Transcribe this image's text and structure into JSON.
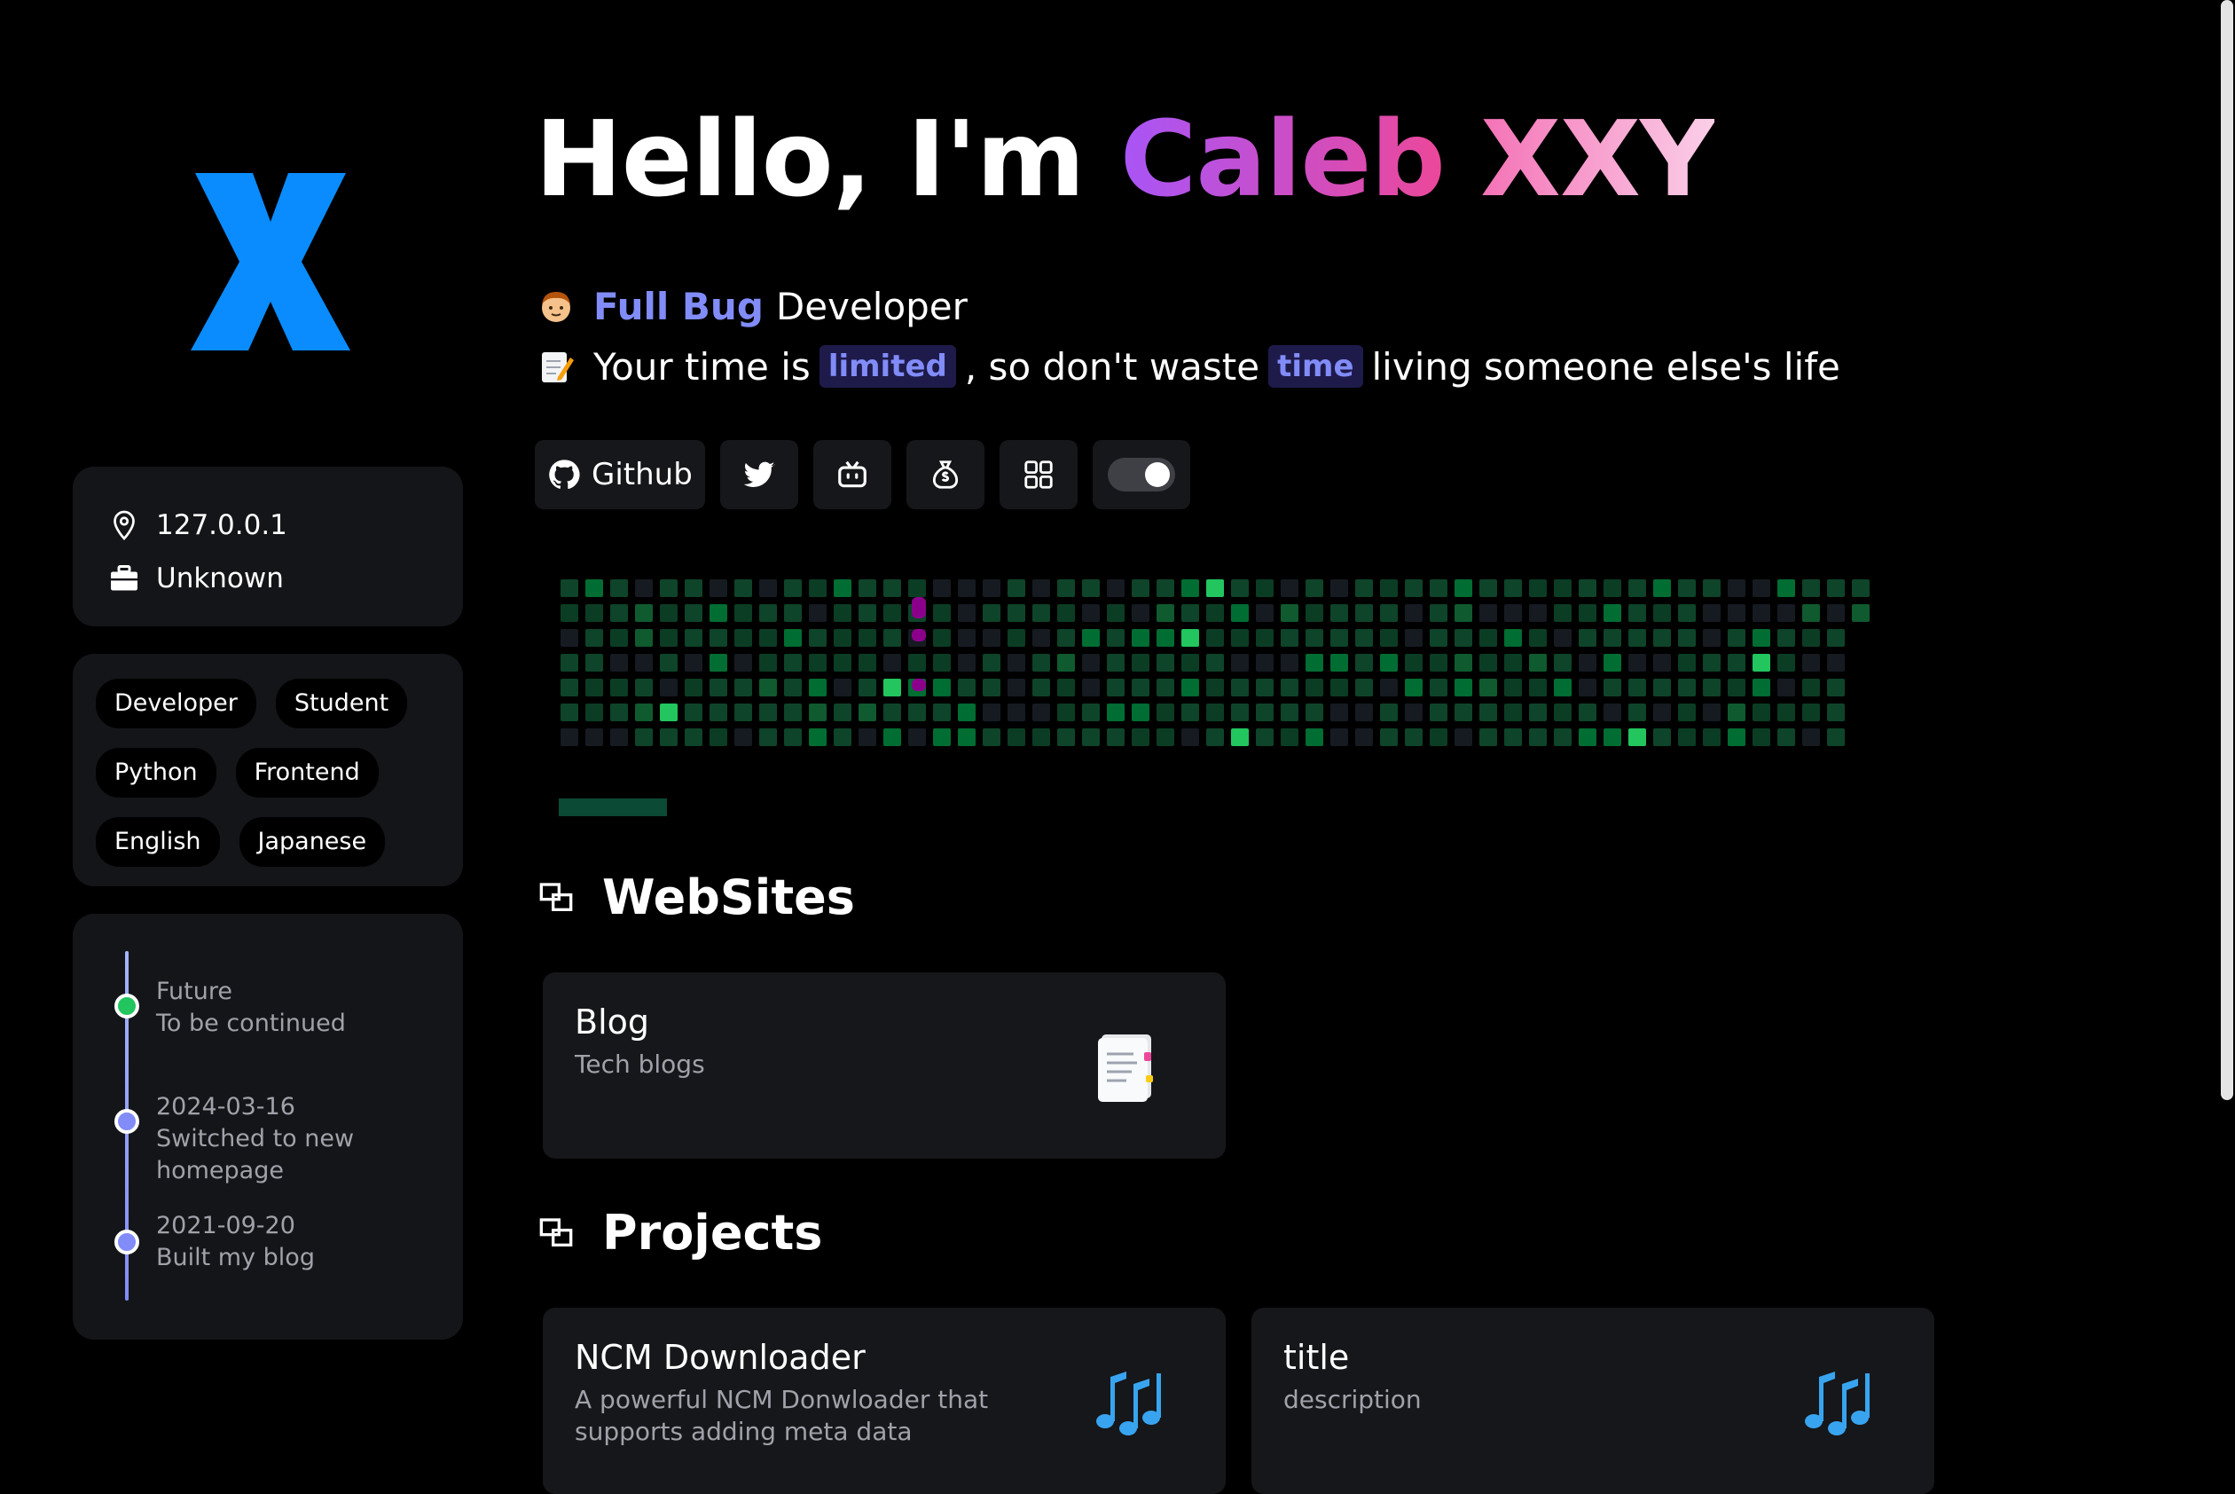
{
  "profile": {
    "avatar_letter": "X",
    "location": "127.0.0.1",
    "job": "Unknown",
    "tags": [
      "Developer",
      "Student",
      "Python",
      "Frontend",
      "English",
      "Japanese"
    ]
  },
  "timeline": [
    {
      "date": "Future",
      "text": "To be continued"
    },
    {
      "date": "2024-03-16",
      "text": "Switched to new homepage"
    },
    {
      "date": "2021-09-20",
      "text": "Built my blog"
    }
  ],
  "hero": {
    "greeting": "Hello, I'm ",
    "name_first": "Caleb",
    "name_last": "XXY",
    "role_highlight": "Full Bug",
    "role_rest": "Developer",
    "quote_part1": "Your time is",
    "quote_hl1": "limited",
    "quote_part2": ", so don't waste",
    "quote_hl2": "time",
    "quote_part3": "living someone else's life"
  },
  "buttons": {
    "github_label": "Github",
    "icons": [
      "twitter-icon",
      "bilibili-icon",
      "money-bag-icon",
      "grid-icon",
      "theme-toggle"
    ]
  },
  "sections": {
    "websites_title": "WebSites",
    "projects_title": "Projects"
  },
  "websites": [
    {
      "title": "Blog",
      "desc": "Tech blogs",
      "icon": "document-icon"
    }
  ],
  "projects": [
    {
      "title": "NCM Downloader",
      "desc": "A powerful NCM Donwloader that supports adding meta data",
      "icon": "music-notes-icon"
    },
    {
      "title": "title",
      "desc": "description",
      "icon": "music-notes-icon"
    }
  ],
  "colors": {
    "accent": "#818cf8",
    "avatar_blue": "#0a8cff",
    "card_bg": "#141518"
  }
}
